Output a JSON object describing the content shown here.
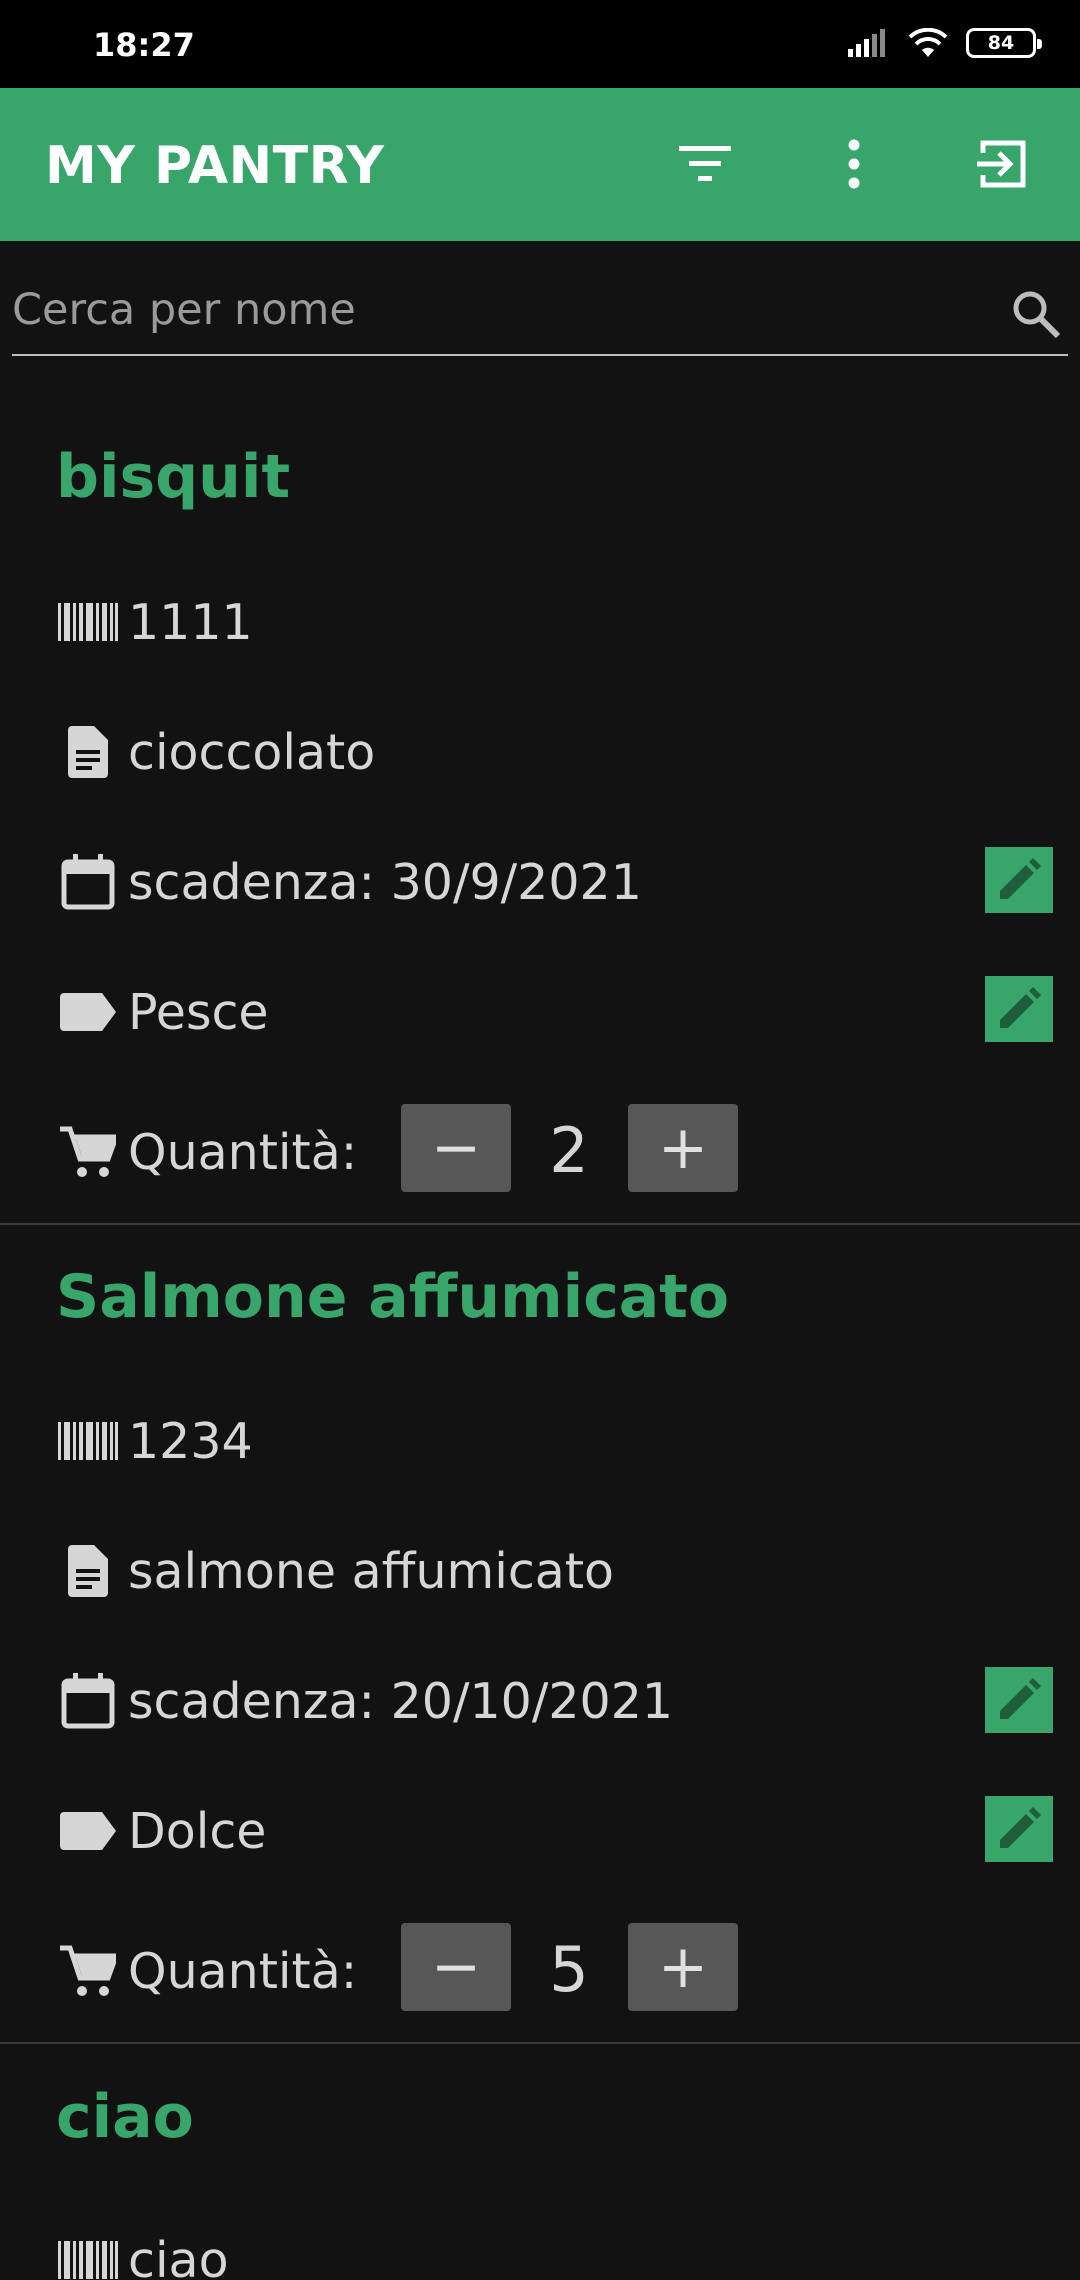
{
  "status_bar": {
    "time": "18:27",
    "battery": "84"
  },
  "app_bar": {
    "title": "MY PANTRY",
    "icons": [
      "filter-icon",
      "more-vert-icon",
      "exit-icon"
    ]
  },
  "search": {
    "placeholder": "Cerca per nome",
    "value": ""
  },
  "colors": {
    "accent": "#38a56b",
    "background": "#121212",
    "qty_button": "#575757"
  },
  "products": [
    {
      "name": "bisquit",
      "barcode": "1111",
      "description": "cioccolato",
      "expiry": "scadenza: 30/9/2021",
      "category": "Pesce",
      "quantity_label": "Quantità:",
      "quantity": "2",
      "minus": "−",
      "plus": "+"
    },
    {
      "name": "Salmone affumicato",
      "barcode": "1234",
      "description": "salmone affumicato",
      "expiry": "scadenza: 20/10/2021",
      "category": "Dolce",
      "quantity_label": "Quantità:",
      "quantity": "5",
      "minus": "−",
      "plus": "+"
    },
    {
      "name": "ciao",
      "barcode": "ciao"
    }
  ]
}
